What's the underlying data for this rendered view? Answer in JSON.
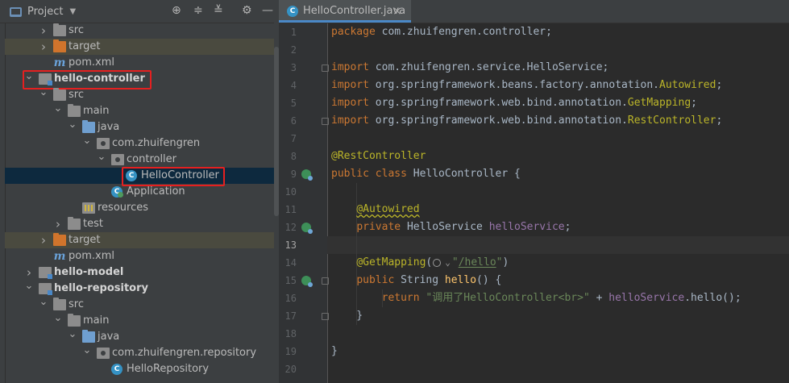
{
  "project_panel": {
    "title": "Project",
    "toolbar": [
      "locate",
      "expand",
      "collapse",
      "settings",
      "hide"
    ],
    "tree": [
      {
        "label": "src",
        "depth": 2,
        "icon": "folder",
        "arrow": "collapsed"
      },
      {
        "label": "target",
        "depth": 2,
        "icon": "folder-orange",
        "arrow": "collapsed",
        "band": "#4a4a3f"
      },
      {
        "label": "pom.xml",
        "depth": 2,
        "icon": "maven",
        "arrow": "none"
      },
      {
        "label": "hello-controller",
        "depth": 1,
        "icon": "module",
        "arrow": "expanded",
        "bold": true,
        "boxed": true
      },
      {
        "label": "src",
        "depth": 2,
        "icon": "folder",
        "arrow": "expanded"
      },
      {
        "label": "main",
        "depth": 3,
        "icon": "folder",
        "arrow": "expanded"
      },
      {
        "label": "java",
        "depth": 4,
        "icon": "folder-blue",
        "arrow": "expanded"
      },
      {
        "label": "com.zhuifengren",
        "depth": 5,
        "icon": "package",
        "arrow": "expanded"
      },
      {
        "label": "controller",
        "depth": 6,
        "icon": "package",
        "arrow": "expanded"
      },
      {
        "label": "HelloController",
        "depth": 7,
        "icon": "class",
        "arrow": "none",
        "selected": true,
        "boxed": true
      },
      {
        "label": "Application",
        "depth": 6,
        "icon": "class-run",
        "arrow": "none"
      },
      {
        "label": "resources",
        "depth": 4,
        "icon": "resources",
        "arrow": "none"
      },
      {
        "label": "test",
        "depth": 3,
        "icon": "folder",
        "arrow": "collapsed"
      },
      {
        "label": "target",
        "depth": 2,
        "icon": "folder-orange",
        "arrow": "collapsed",
        "band": "#4a4a3f"
      },
      {
        "label": "pom.xml",
        "depth": 2,
        "icon": "maven",
        "arrow": "none"
      },
      {
        "label": "hello-model",
        "depth": 1,
        "icon": "module",
        "arrow": "collapsed",
        "bold": true
      },
      {
        "label": "hello-repository",
        "depth": 1,
        "icon": "module",
        "arrow": "expanded",
        "bold": true
      },
      {
        "label": "src",
        "depth": 2,
        "icon": "folder",
        "arrow": "expanded"
      },
      {
        "label": "main",
        "depth": 3,
        "icon": "folder",
        "arrow": "expanded"
      },
      {
        "label": "java",
        "depth": 4,
        "icon": "folder-blue",
        "arrow": "expanded"
      },
      {
        "label": "com.zhuifengren.repository",
        "depth": 5,
        "icon": "package",
        "arrow": "expanded"
      },
      {
        "label": "HelloRepository",
        "depth": 6,
        "icon": "class",
        "arrow": "none"
      }
    ]
  },
  "editor": {
    "tab_label": "HelloController.java",
    "tab_close": "×",
    "current_line": 13,
    "lines": [
      {
        "n": 1,
        "tokens": [
          [
            "kw",
            "package "
          ],
          [
            "",
            "com.zhuifengren.controller;"
          ]
        ]
      },
      {
        "n": 2,
        "tokens": []
      },
      {
        "n": 3,
        "fold": true,
        "tokens": [
          [
            "kw",
            "import "
          ],
          [
            "",
            "com.zhuifengren.service.HelloService;"
          ]
        ]
      },
      {
        "n": 4,
        "tokens": [
          [
            "kw",
            "import "
          ],
          [
            "",
            "org.springframework.beans.factory.annotation."
          ],
          [
            "ann",
            "Autowired"
          ],
          [
            "",
            ";"
          ]
        ]
      },
      {
        "n": 5,
        "tokens": [
          [
            "kw",
            "import "
          ],
          [
            "",
            "org.springframework.web.bind.annotation."
          ],
          [
            "ann",
            "GetMapping"
          ],
          [
            "",
            ";"
          ]
        ]
      },
      {
        "n": 6,
        "fold": true,
        "tokens": [
          [
            "kw",
            "import "
          ],
          [
            "",
            "org.springframework.web.bind.annotation."
          ],
          [
            "ann",
            "RestController"
          ],
          [
            "",
            ";"
          ]
        ]
      },
      {
        "n": 7,
        "tokens": []
      },
      {
        "n": 8,
        "tokens": [
          [
            "ann",
            "@RestController"
          ]
        ]
      },
      {
        "n": 9,
        "gutter_icon": "bean-icon",
        "tokens": [
          [
            "kw",
            "public class "
          ],
          [
            "",
            "HelloController {"
          ]
        ]
      },
      {
        "n": 10,
        "tokens": []
      },
      {
        "n": 11,
        "tokens": [
          [
            "",
            "    "
          ],
          [
            "ann squig",
            "@Autowired"
          ]
        ]
      },
      {
        "n": 12,
        "gutter_icon": "bean-icon",
        "tokens": [
          [
            "",
            "    "
          ],
          [
            "kw",
            "private "
          ],
          [
            "",
            "HelloService "
          ],
          [
            "fld",
            "helloService"
          ],
          [
            "",
            ";"
          ]
        ]
      },
      {
        "n": 13,
        "tokens": []
      },
      {
        "n": 14,
        "tokens": [
          [
            "",
            "    "
          ],
          [
            "ann",
            "@GetMapping"
          ],
          [
            "",
            "("
          ],
          [
            "chip",
            ""
          ],
          [
            "str",
            "\""
          ],
          [
            "str squig-url",
            "/hello"
          ],
          [
            "str",
            "\""
          ],
          [
            "",
            ")"
          ]
        ]
      },
      {
        "n": 15,
        "gutter_icon": "bean-icon",
        "fold": true,
        "tokens": [
          [
            "",
            "    "
          ],
          [
            "kw",
            "public "
          ],
          [
            "",
            "String "
          ],
          [
            "fn",
            "hello"
          ],
          [
            "",
            "() {"
          ]
        ]
      },
      {
        "n": 16,
        "tokens": [
          [
            "",
            "        "
          ],
          [
            "kw",
            "return "
          ],
          [
            "str",
            "\"调用了HelloController<br>\""
          ],
          [
            "",
            " + "
          ],
          [
            "fld",
            "helloService"
          ],
          [
            "",
            ".hello();"
          ]
        ]
      },
      {
        "n": 17,
        "fold": true,
        "tokens": [
          [
            "",
            "    }"
          ]
        ]
      },
      {
        "n": 18,
        "tokens": []
      },
      {
        "n": 19,
        "tokens": [
          [
            "",
            "}"
          ]
        ]
      },
      {
        "n": 20,
        "tokens": []
      }
    ]
  },
  "colors": {
    "selection": "#0d293e",
    "highlight_box": "#e52020",
    "accent": "#4a88c7"
  }
}
